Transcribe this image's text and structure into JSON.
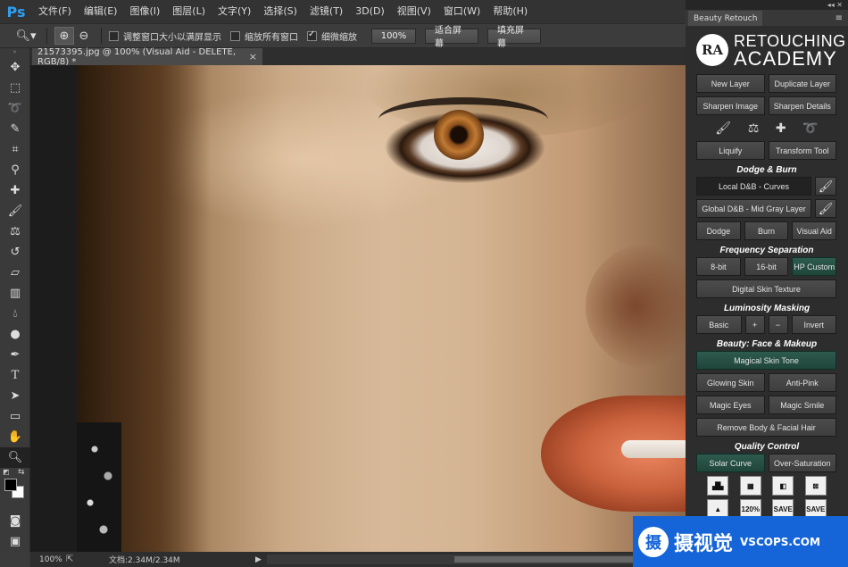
{
  "app": {
    "logo": "Ps"
  },
  "menu": [
    "文件(F)",
    "编辑(E)",
    "图像(I)",
    "图层(L)",
    "文字(Y)",
    "选择(S)",
    "滤镜(T)",
    "3D(D)",
    "视图(V)",
    "窗口(W)",
    "帮助(H)"
  ],
  "window_controls": {
    "minimize": "—",
    "restore": "❐",
    "close": "✕"
  },
  "options_bar": {
    "tool_icon": "zoom-icon",
    "checks": [
      {
        "label": "调整窗口大小以满屏显示",
        "checked": false
      },
      {
        "label": "缩放所有窗口",
        "checked": false
      },
      {
        "label": "细微缩放",
        "checked": true
      }
    ],
    "buttons": [
      "100%",
      "适合屏幕",
      "填充屏幕"
    ]
  },
  "toolbox": [
    "move",
    "marquee",
    "lasso",
    "quick-select",
    "crop",
    "eyedropper",
    "healing",
    "brush",
    "stamp",
    "history-brush",
    "eraser",
    "gradient",
    "blur",
    "dodge",
    "pen",
    "type",
    "path-select",
    "shape",
    "hand",
    "zoom"
  ],
  "document_tab": {
    "title": "21573395.jpg @ 100% (Visual Aid - DELETE, RGB/8) *",
    "close": "×"
  },
  "status": {
    "zoom": "100%",
    "doc_size": "文档:2.34M/2.34M",
    "arrow": "▶"
  },
  "panel": {
    "top_controls": "◂◂ ✕",
    "tab": "Beauty Retouch",
    "menu_icon": "≡",
    "logo": {
      "mark": "RA",
      "line1": "RETOUCHING",
      "line2": "ACADEMY"
    },
    "rows1": [
      [
        "New Layer",
        "Duplicate Layer"
      ],
      [
        "Sharpen Image",
        "Sharpen Details"
      ]
    ],
    "rows2": [
      [
        "Liquify",
        "Transform Tool"
      ]
    ],
    "sections": {
      "dodge_burn": "Dodge & Burn",
      "frequency": "Frequency Separation",
      "luminosity": "Luminosity Masking",
      "beauty": "Beauty: Face & Makeup",
      "quality": "Quality Control"
    },
    "dodge_burn": {
      "local": "Local D&B - Curves",
      "global": "Global D&B - Mid Gray Layer",
      "row": [
        "Dodge",
        "Burn",
        "Visual Aid"
      ]
    },
    "frequency": {
      "row": [
        "8-bit",
        "16-bit",
        "HP Custom"
      ],
      "skin_texture": "Digital Skin Texture"
    },
    "luminosity": {
      "row": [
        "Basic",
        "+",
        "−",
        "Invert"
      ]
    },
    "beauty": {
      "skin_tone": "Magical Skin Tone",
      "rows": [
        [
          "Glowing Skin",
          "Anti-Pink"
        ],
        [
          "Magic Eyes",
          "Magic Smile"
        ]
      ],
      "hair": "Remove Body & Facial Hair"
    },
    "quality": {
      "row": [
        "Solar Curve",
        "Over-Saturation"
      ],
      "tiles_top": [
        "",
        "",
        "",
        ""
      ],
      "tiles_bottom": [
        "",
        "120%",
        "SAVE",
        "SAVE"
      ]
    }
  },
  "watermark": {
    "icon": "摄",
    "text": "摄视觉",
    "sub": "VSCOPS.COM"
  }
}
